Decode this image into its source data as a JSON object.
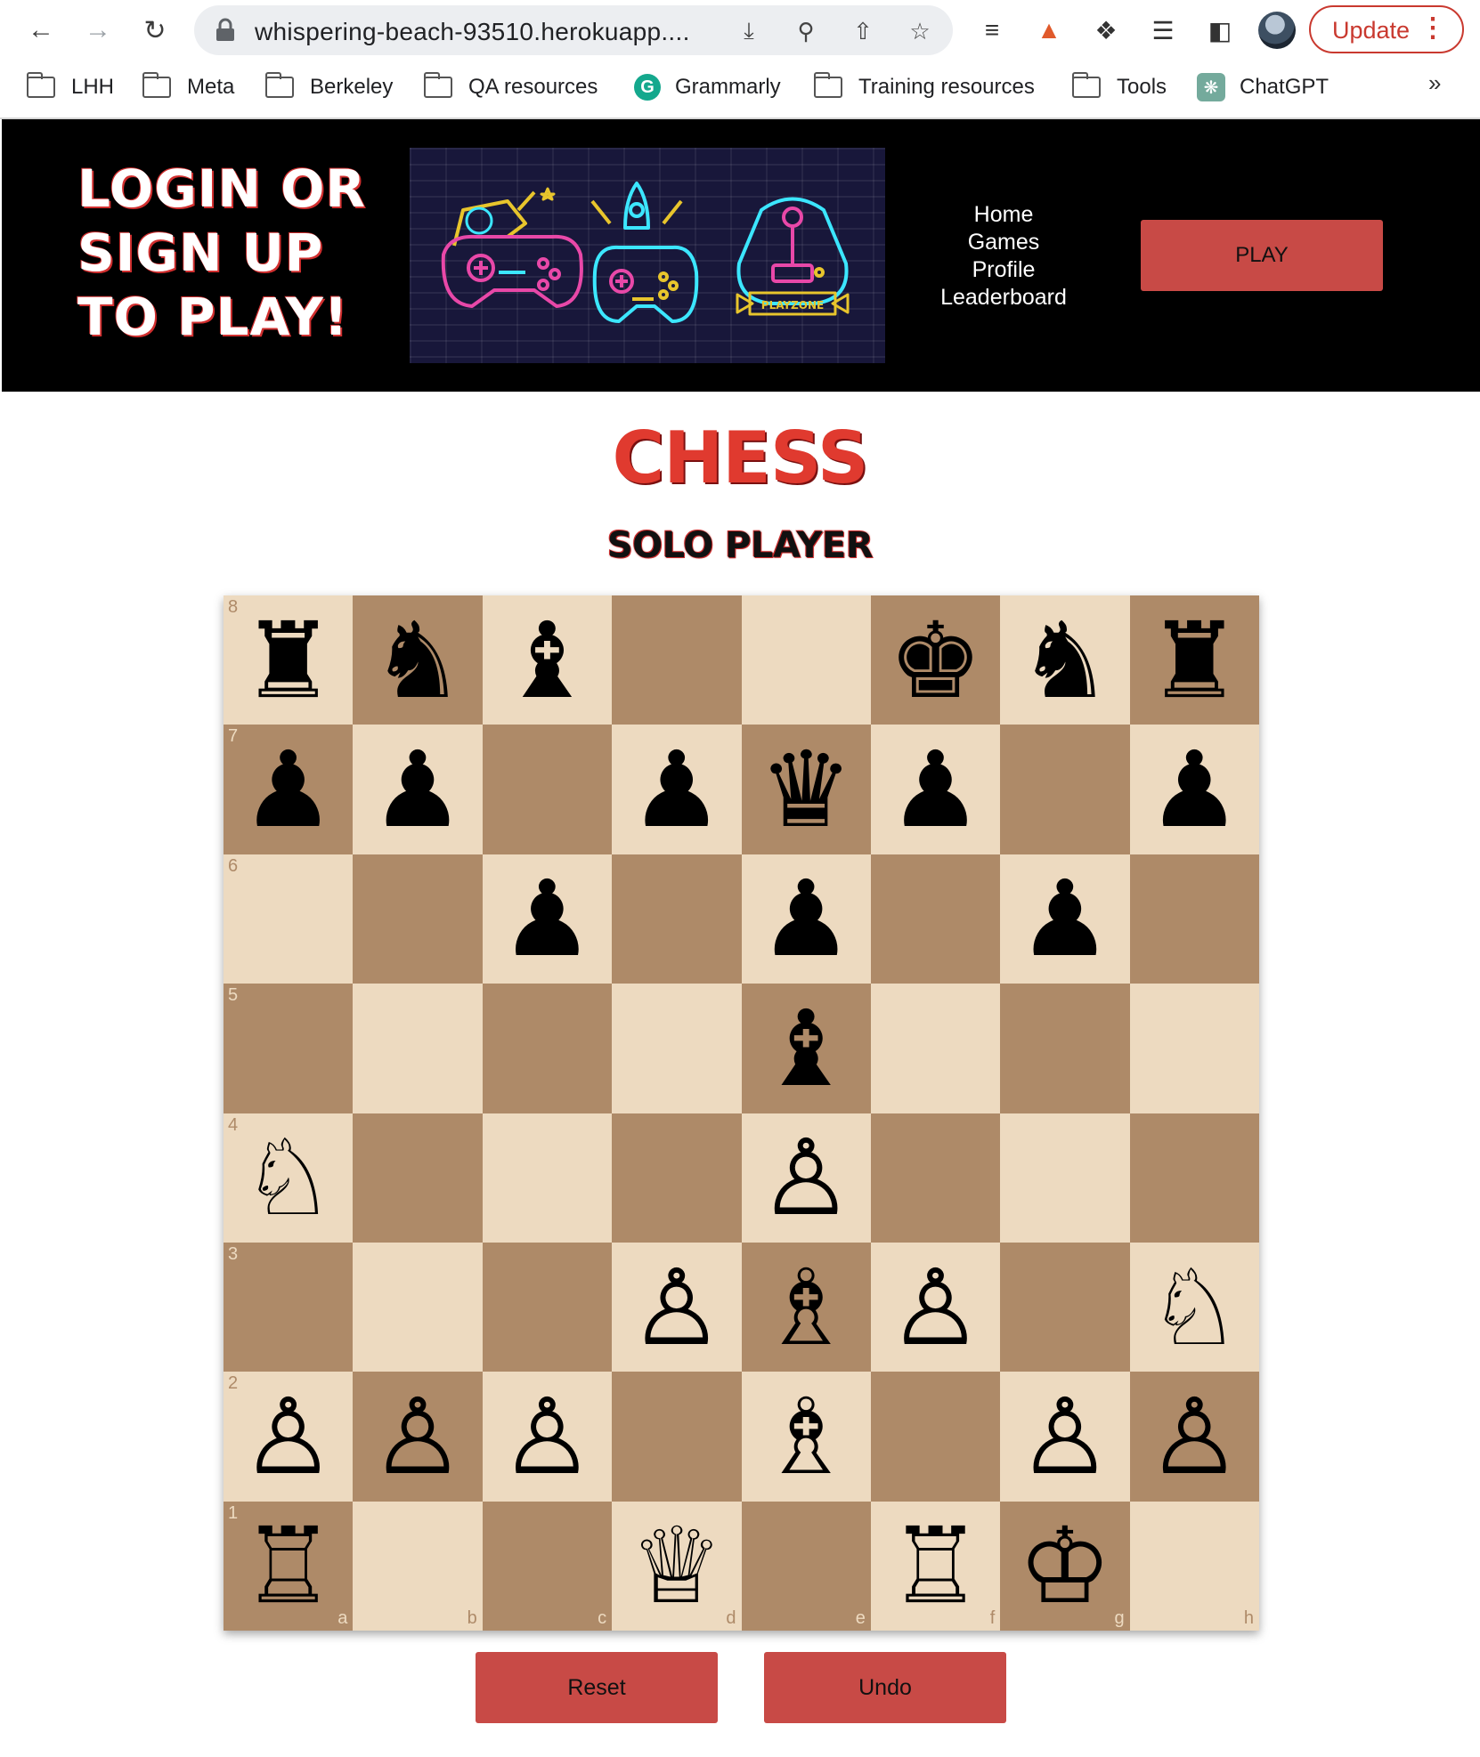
{
  "browser": {
    "url": "whispering-beach-93510.herokuapp....",
    "update_label": "Update",
    "bookmarks": [
      {
        "label": "LHH",
        "icon": "folder-icon"
      },
      {
        "label": "Meta",
        "icon": "folder-icon"
      },
      {
        "label": "Berkeley",
        "icon": "folder-icon"
      },
      {
        "label": "QA resources",
        "icon": "folder-icon"
      },
      {
        "label": "Grammarly",
        "icon": "grammarly-icon"
      },
      {
        "label": "Training resources",
        "icon": "folder-icon"
      },
      {
        "label": "Tools",
        "icon": "folder-icon"
      },
      {
        "label": "ChatGPT",
        "icon": "chatgpt-icon"
      }
    ],
    "more_label": "»"
  },
  "header": {
    "login_title": "LOGIN OR SIGN UP TO PLAY!",
    "banner_text": "PLAYZONE",
    "nav": [
      "Home",
      "Games",
      "Profile",
      "Leaderboard"
    ],
    "play_label": "PLAY"
  },
  "main": {
    "title": "CHESS",
    "subtitle": "SOLO PLAYER"
  },
  "board": {
    "ranks": [
      "8",
      "7",
      "6",
      "5",
      "4",
      "3",
      "2",
      "1"
    ],
    "files": [
      "a",
      "b",
      "c",
      "d",
      "e",
      "f",
      "g",
      "h"
    ],
    "colors": {
      "light": "#eddac0",
      "dark": "#ae8a68"
    },
    "position": [
      [
        "r",
        "n",
        "b",
        "",
        "",
        "k",
        "n",
        "r"
      ],
      [
        "p",
        "p",
        "",
        "p",
        "q",
        "p",
        "",
        "p"
      ],
      [
        "",
        "",
        "p",
        "",
        "p",
        "",
        "p",
        ""
      ],
      [
        "",
        "",
        "",
        "",
        "b",
        "",
        "",
        ""
      ],
      [
        "N",
        "",
        "",
        "",
        "P",
        "",
        "",
        ""
      ],
      [
        "",
        "",
        "",
        "P",
        "B",
        "P",
        "",
        "N"
      ],
      [
        "P",
        "P",
        "P",
        "",
        "B",
        "",
        "P",
        "P"
      ],
      [
        "R",
        "",
        "",
        "Q",
        "",
        "R",
        "K",
        ""
      ]
    ]
  },
  "controls": {
    "reset_label": "Reset",
    "undo_label": "Undo"
  },
  "colors": {
    "accent": "#c84a46",
    "title_red": "#e03a2f"
  }
}
